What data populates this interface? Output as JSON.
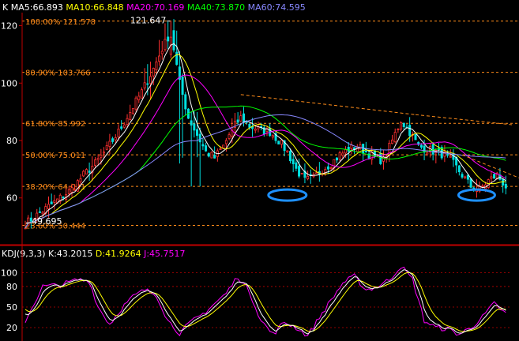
{
  "main_header": {
    "prefix": "K",
    "items": [
      {
        "label": "MA5:66.893",
        "color": "#ffffff"
      },
      {
        "label": "MA10:66.848",
        "color": "#ffff00"
      },
      {
        "label": "MA20:70.169",
        "color": "#ff00ff"
      },
      {
        "label": "MA40:73.870",
        "color": "#00ff00"
      },
      {
        "label": "MA60:74.595",
        "color": "#8888ff"
      }
    ]
  },
  "kdj_header": {
    "prefix": "KDJ(9,3,3)",
    "items": [
      {
        "label": "K:43.2015",
        "color": "#ffffff"
      },
      {
        "label": "D:41.9264",
        "color": "#ffff00"
      },
      {
        "label": "J:45.7517",
        "color": "#ff00ff"
      }
    ]
  },
  "colors": {
    "up": "#ff3030",
    "down": "#00e0e0",
    "fib": "#ff8c1a",
    "grid": "#c00000",
    "axis_text": "#ffffff",
    "ma5": "#ffffff",
    "ma10": "#ffff00",
    "ma20": "#ff00ff",
    "ma40": "#00ff00",
    "ma60": "#8888ff",
    "circle": "#1e90ff"
  },
  "annotations": {
    "high_label": "121.647",
    "low_label": "49.695"
  },
  "chart_data": [
    {
      "type": "candlestick",
      "ylim": [
        47,
        124
      ],
      "y_ticks": [
        120,
        100,
        80,
        60
      ],
      "fib_levels": [
        {
          "label": "100.00% 121.578",
          "value": 121.578
        },
        {
          "label": "80.90% 103.766",
          "value": 103.766
        },
        {
          "label": "61.80% 85.992",
          "value": 85.992
        },
        {
          "label": "50.00% 75.011",
          "value": 75.011
        },
        {
          "label": "38.20% 64.031",
          "value": 64.031
        },
        {
          "label": "23.60% 50.444",
          "value": 50.444
        }
      ],
      "anchors": [
        [
          0,
          51
        ],
        [
          4,
          54
        ],
        [
          8,
          57
        ],
        [
          12,
          60
        ],
        [
          16,
          63
        ],
        [
          20,
          68
        ],
        [
          24,
          72
        ],
        [
          28,
          77
        ],
        [
          32,
          83
        ],
        [
          36,
          90
        ],
        [
          40,
          97
        ],
        [
          44,
          105
        ],
        [
          47,
          112
        ],
        [
          50,
          118
        ],
        [
          53,
          100
        ],
        [
          56,
          88
        ],
        [
          59,
          82
        ],
        [
          62,
          76
        ],
        [
          65,
          74
        ],
        [
          68,
          78
        ],
        [
          71,
          84
        ],
        [
          74,
          88
        ],
        [
          77,
          85
        ],
        [
          80,
          84
        ],
        [
          84,
          83
        ],
        [
          87,
          80
        ],
        [
          90,
          76
        ],
        [
          93,
          70
        ],
        [
          96,
          66
        ],
        [
          99,
          67
        ],
        [
          102,
          70
        ],
        [
          105,
          72
        ],
        [
          108,
          75
        ],
        [
          111,
          77
        ],
        [
          114,
          78
        ],
        [
          117,
          76
        ],
        [
          120,
          74
        ],
        [
          123,
          73
        ],
        [
          126,
          80
        ],
        [
          129,
          87
        ],
        [
          132,
          83
        ],
        [
          135,
          78
        ],
        [
          138,
          77
        ],
        [
          141,
          76
        ],
        [
          144,
          75
        ],
        [
          147,
          72
        ],
        [
          150,
          68
        ],
        [
          153,
          64
        ],
        [
          156,
          63
        ],
        [
          159,
          66
        ],
        [
          162,
          68
        ],
        [
          165,
          64
        ]
      ]
    },
    {
      "type": "line",
      "name": "KDJ",
      "ylim": [
        5,
        118
      ],
      "y_ticks": [
        100,
        80,
        50,
        20
      ],
      "anchors": [
        [
          0,
          30
        ],
        [
          6,
          80
        ],
        [
          12,
          82
        ],
        [
          18,
          90
        ],
        [
          22,
          88
        ],
        [
          25,
          50
        ],
        [
          29,
          25
        ],
        [
          33,
          48
        ],
        [
          37,
          65
        ],
        [
          41,
          75
        ],
        [
          45,
          68
        ],
        [
          49,
          30
        ],
        [
          53,
          12
        ],
        [
          57,
          28
        ],
        [
          61,
          40
        ],
        [
          65,
          55
        ],
        [
          69,
          70
        ],
        [
          73,
          95
        ],
        [
          77,
          72
        ],
        [
          81,
          30
        ],
        [
          85,
          10
        ],
        [
          89,
          28
        ],
        [
          93,
          20
        ],
        [
          97,
          8
        ],
        [
          101,
          35
        ],
        [
          105,
          60
        ],
        [
          109,
          85
        ],
        [
          113,
          95
        ],
        [
          117,
          75
        ],
        [
          121,
          80
        ],
        [
          125,
          90
        ],
        [
          129,
          110
        ],
        [
          133,
          90
        ],
        [
          137,
          30
        ],
        [
          141,
          20
        ],
        [
          145,
          18
        ],
        [
          149,
          10
        ],
        [
          153,
          20
        ],
        [
          157,
          35
        ],
        [
          161,
          55
        ],
        [
          165,
          40
        ]
      ]
    }
  ]
}
